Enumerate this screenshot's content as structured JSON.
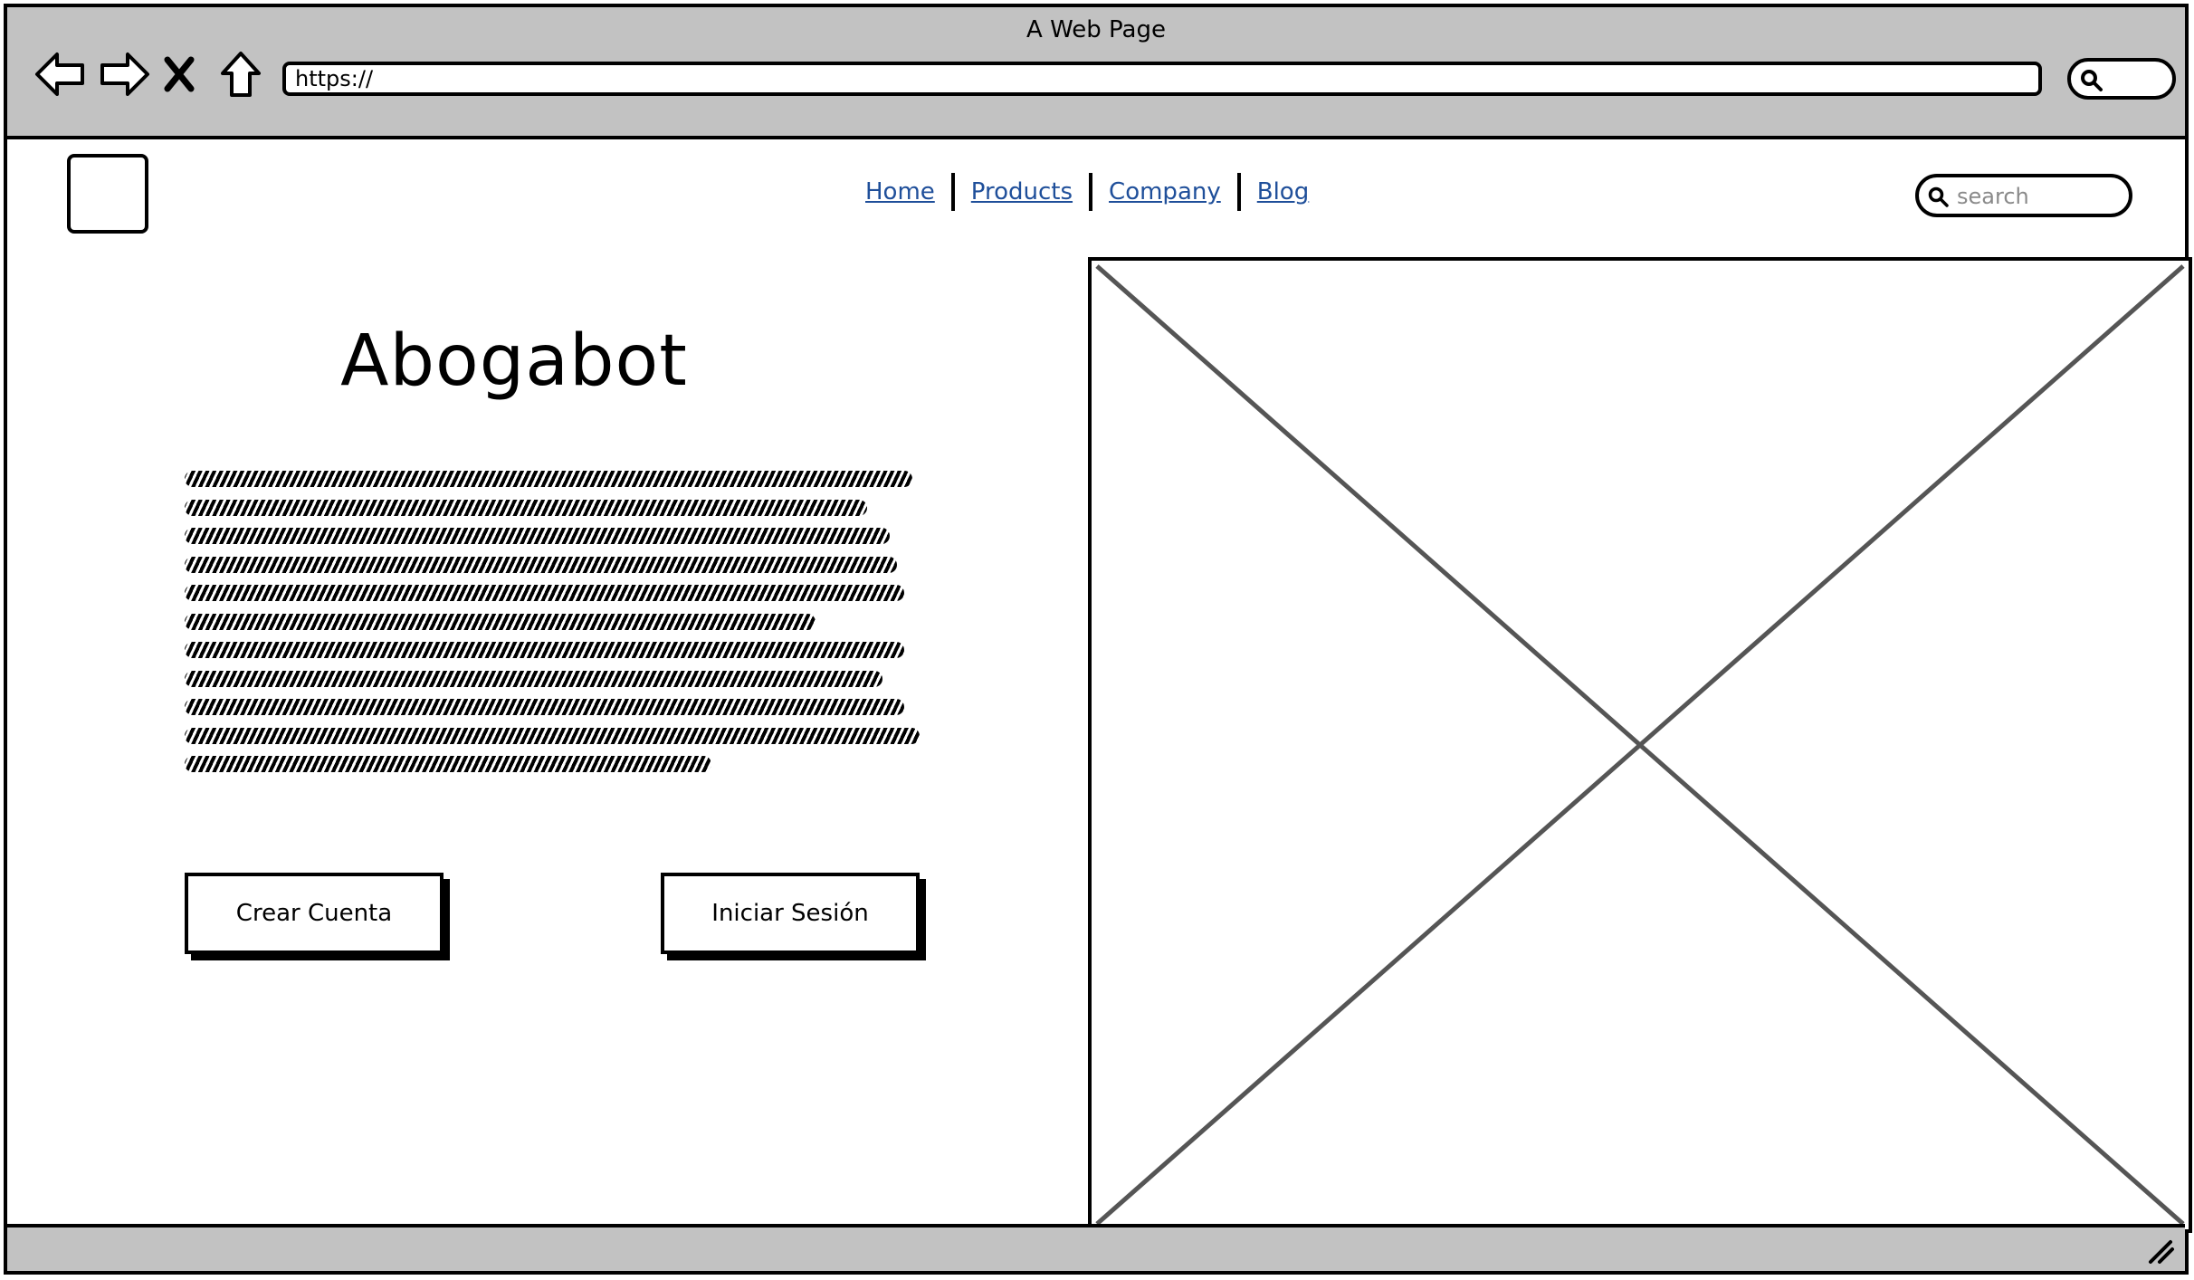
{
  "window": {
    "title": "A Web Page"
  },
  "browser": {
    "url": "https://",
    "icons": {
      "back": "back-arrow-icon",
      "forward": "forward-arrow-icon",
      "stop": "stop-x-icon",
      "home": "home-icon",
      "search": "search-icon"
    }
  },
  "site": {
    "nav": {
      "home": "Home",
      "products": "Products",
      "company": "Company",
      "blog": "Blog"
    },
    "search": {
      "placeholder": "search"
    },
    "hero": {
      "title": "Abogabot",
      "create_account": "Crear Cuenta",
      "login": "Iniciar Sesión"
    }
  },
  "colors": {
    "chrome": "#c2c2c2",
    "link": "#1f4f9a",
    "border": "#000000"
  }
}
